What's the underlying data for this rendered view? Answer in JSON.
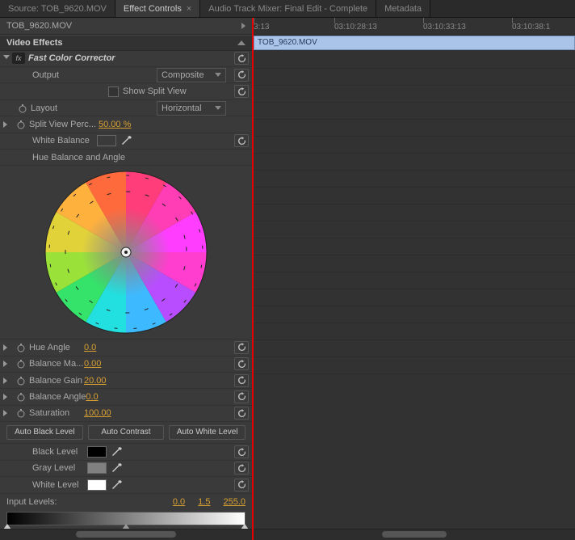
{
  "tabs": {
    "source": "Source: TOB_9620.MOV",
    "effect": "Effect Controls",
    "mixer": "Audio Track Mixer: Final Edit - Complete",
    "metadata": "Metadata"
  },
  "clip": {
    "name": "TOB_9620.MOV"
  },
  "section": {
    "video_effects": "Video Effects"
  },
  "effect": {
    "name": "Fast Color Corrector",
    "output": {
      "label": "Output",
      "value": "Composite"
    },
    "show_split": {
      "label": "Show Split View"
    },
    "layout": {
      "label": "Layout",
      "value": "Horizontal"
    },
    "split_pct": {
      "label": "Split View Perc...",
      "value": "50.00 %"
    },
    "white_balance": {
      "label": "White Balance",
      "swatch": "#ffffff"
    },
    "hue_heading": "Hue Balance and Angle",
    "hue_angle": {
      "label": "Hue Angle",
      "value": "0.0"
    },
    "balance_mag": {
      "label": "Balance Ma...",
      "value": "0.00"
    },
    "balance_gain": {
      "label": "Balance Gain",
      "value": "20.00"
    },
    "balance_angle": {
      "label": "Balance Angle",
      "value": "0.0"
    },
    "saturation": {
      "label": "Saturation",
      "value": "100.00"
    },
    "auto": {
      "black": "Auto Black Level",
      "contrast": "Auto Contrast",
      "white": "Auto White Level"
    },
    "black_level": {
      "label": "Black Level",
      "swatch": "#000000"
    },
    "gray_level": {
      "label": "Gray Level",
      "swatch": "#808080"
    },
    "white_level": {
      "label": "White Level",
      "swatch": "#ffffff"
    },
    "input_levels": {
      "label": "Input Levels:",
      "low": "0.0",
      "mid": "1.5",
      "high": "255.0"
    }
  },
  "timeline": {
    "clip_label": "TOB_9620.MOV",
    "ticks": [
      "3:13",
      "03:10:28:13",
      "03:10:33:13",
      "03:10:38:1"
    ]
  }
}
